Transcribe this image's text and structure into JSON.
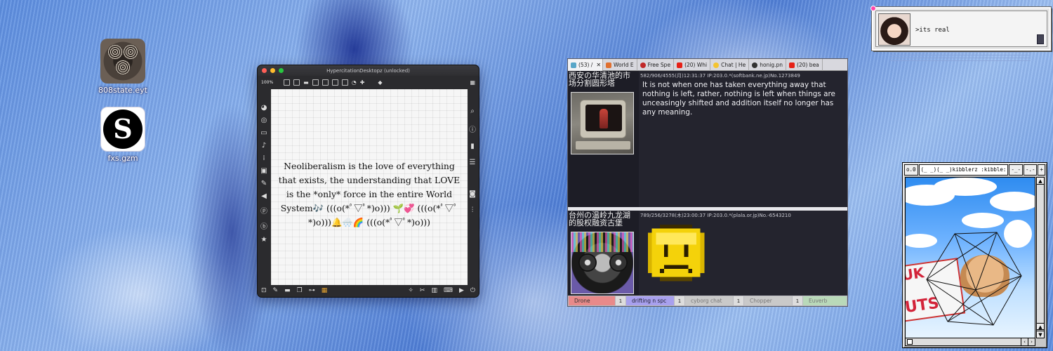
{
  "desktop": {
    "icons": [
      {
        "label": "808state.eyt",
        "icon": "speaker-cluster-icon"
      },
      {
        "label": "fxs.gzm",
        "icon": "s-logo-icon"
      }
    ]
  },
  "hyper_window": {
    "title": "HypercitationDesktopz (unlocked)",
    "zoom": "100%",
    "toolbar_icons": [
      "rect-tool-icon",
      "text-tool-icon",
      "speech-tool-icon",
      "x-tool-icon",
      "target-tool-icon",
      "play-tool-icon",
      "minus-tool-icon",
      "clock-tool-icon",
      "plus-tool-icon",
      "paint-bucket-icon",
      "grid-icon"
    ],
    "left_tools": [
      "palette-icon",
      "target-icon",
      "rect-icon",
      "music-note-icon",
      "sequence-icon",
      "image-icon",
      "clip-icon",
      "bird-icon",
      "p-circle-icon",
      "b-circle-icon",
      "star-icon"
    ],
    "right_tools": [
      "search-icon",
      "info-icon",
      "book-icon",
      "list-icon",
      "camera-icon",
      "sliders-icon"
    ],
    "bottom_tools": [
      "lock-icon",
      "edit-icon",
      "comment-icon",
      "layers-icon",
      "link-icon",
      "grid-icon",
      "sparkle-icon",
      "wrench-icon",
      "piano-icon",
      "keyboard-icon",
      "play-icon",
      "power-icon"
    ],
    "canvas_text": "Neoliberalism is the love of everything that exists, the understanding that LOVE is the *only* force in the entire World System🎶 (((o(*ﾟ▽ﾟ*)o))) 🌱💞 (((o(*ﾟ▽ﾟ*)o)))🔔🌨️🌈 (((o(*ﾟ▽ﾟ*)o)))"
  },
  "browser": {
    "tabs": [
      {
        "label": "(53) /",
        "color": "#58a6c8",
        "active": true
      },
      {
        "label": "World E",
        "color": "#e07030"
      },
      {
        "label": "Free Spe",
        "color": "#c02828"
      },
      {
        "label": "(20) Whi",
        "color": "#e62117"
      },
      {
        "label": "Chat | He",
        "color": "#f4c430"
      },
      {
        "label": "honig.pn",
        "color": "#333333"
      },
      {
        "label": "(20) bea",
        "color": "#e62117"
      }
    ],
    "post1": {
      "title": "西安の华清池的市场分割圆形塔",
      "meta": "582/906/4555(月)12:31:37 IP:203.0.*(softbank.ne.jp)No.1273849",
      "body": "It is not when one has taken everything away that nothing is left, rather, nothing is left when things are unceasingly shifted and addition itself no longer has any meaning."
    },
    "post2": {
      "title": "台州の温岭九龙湖的股权融资古堡",
      "meta": "789/256/3278(木)23:00:37 IP:203.0.*(plala.or.jp)No.-6543210"
    },
    "statusbar": [
      {
        "label": "Drone",
        "num": "1",
        "color": "#e88a8a",
        "text_color": "#333"
      },
      {
        "label": "drifting n spc",
        "num": "1",
        "color": "#a8a0ee",
        "text_color": "#223"
      },
      {
        "label": "cyborg chat",
        "num": "1",
        "color": "#c9c9c9",
        "text_color": "#777"
      },
      {
        "label": "Chopper",
        "num": "1",
        "color": "#c9c9c9",
        "text_color": "#777"
      },
      {
        "label": "Euverb",
        "num": "",
        "color": "#b9d9b9",
        "text_color": "#777"
      }
    ]
  },
  "chat": {
    "message": ">its real"
  },
  "retro_window": {
    "tabs": [
      "o.0",
      "(_ _)(_ _)kibblerz :kibble:",
      "-_-",
      "-.-",
      "+"
    ],
    "sign_letters_top": "UK",
    "sign_letters_bottom": "UTS"
  }
}
